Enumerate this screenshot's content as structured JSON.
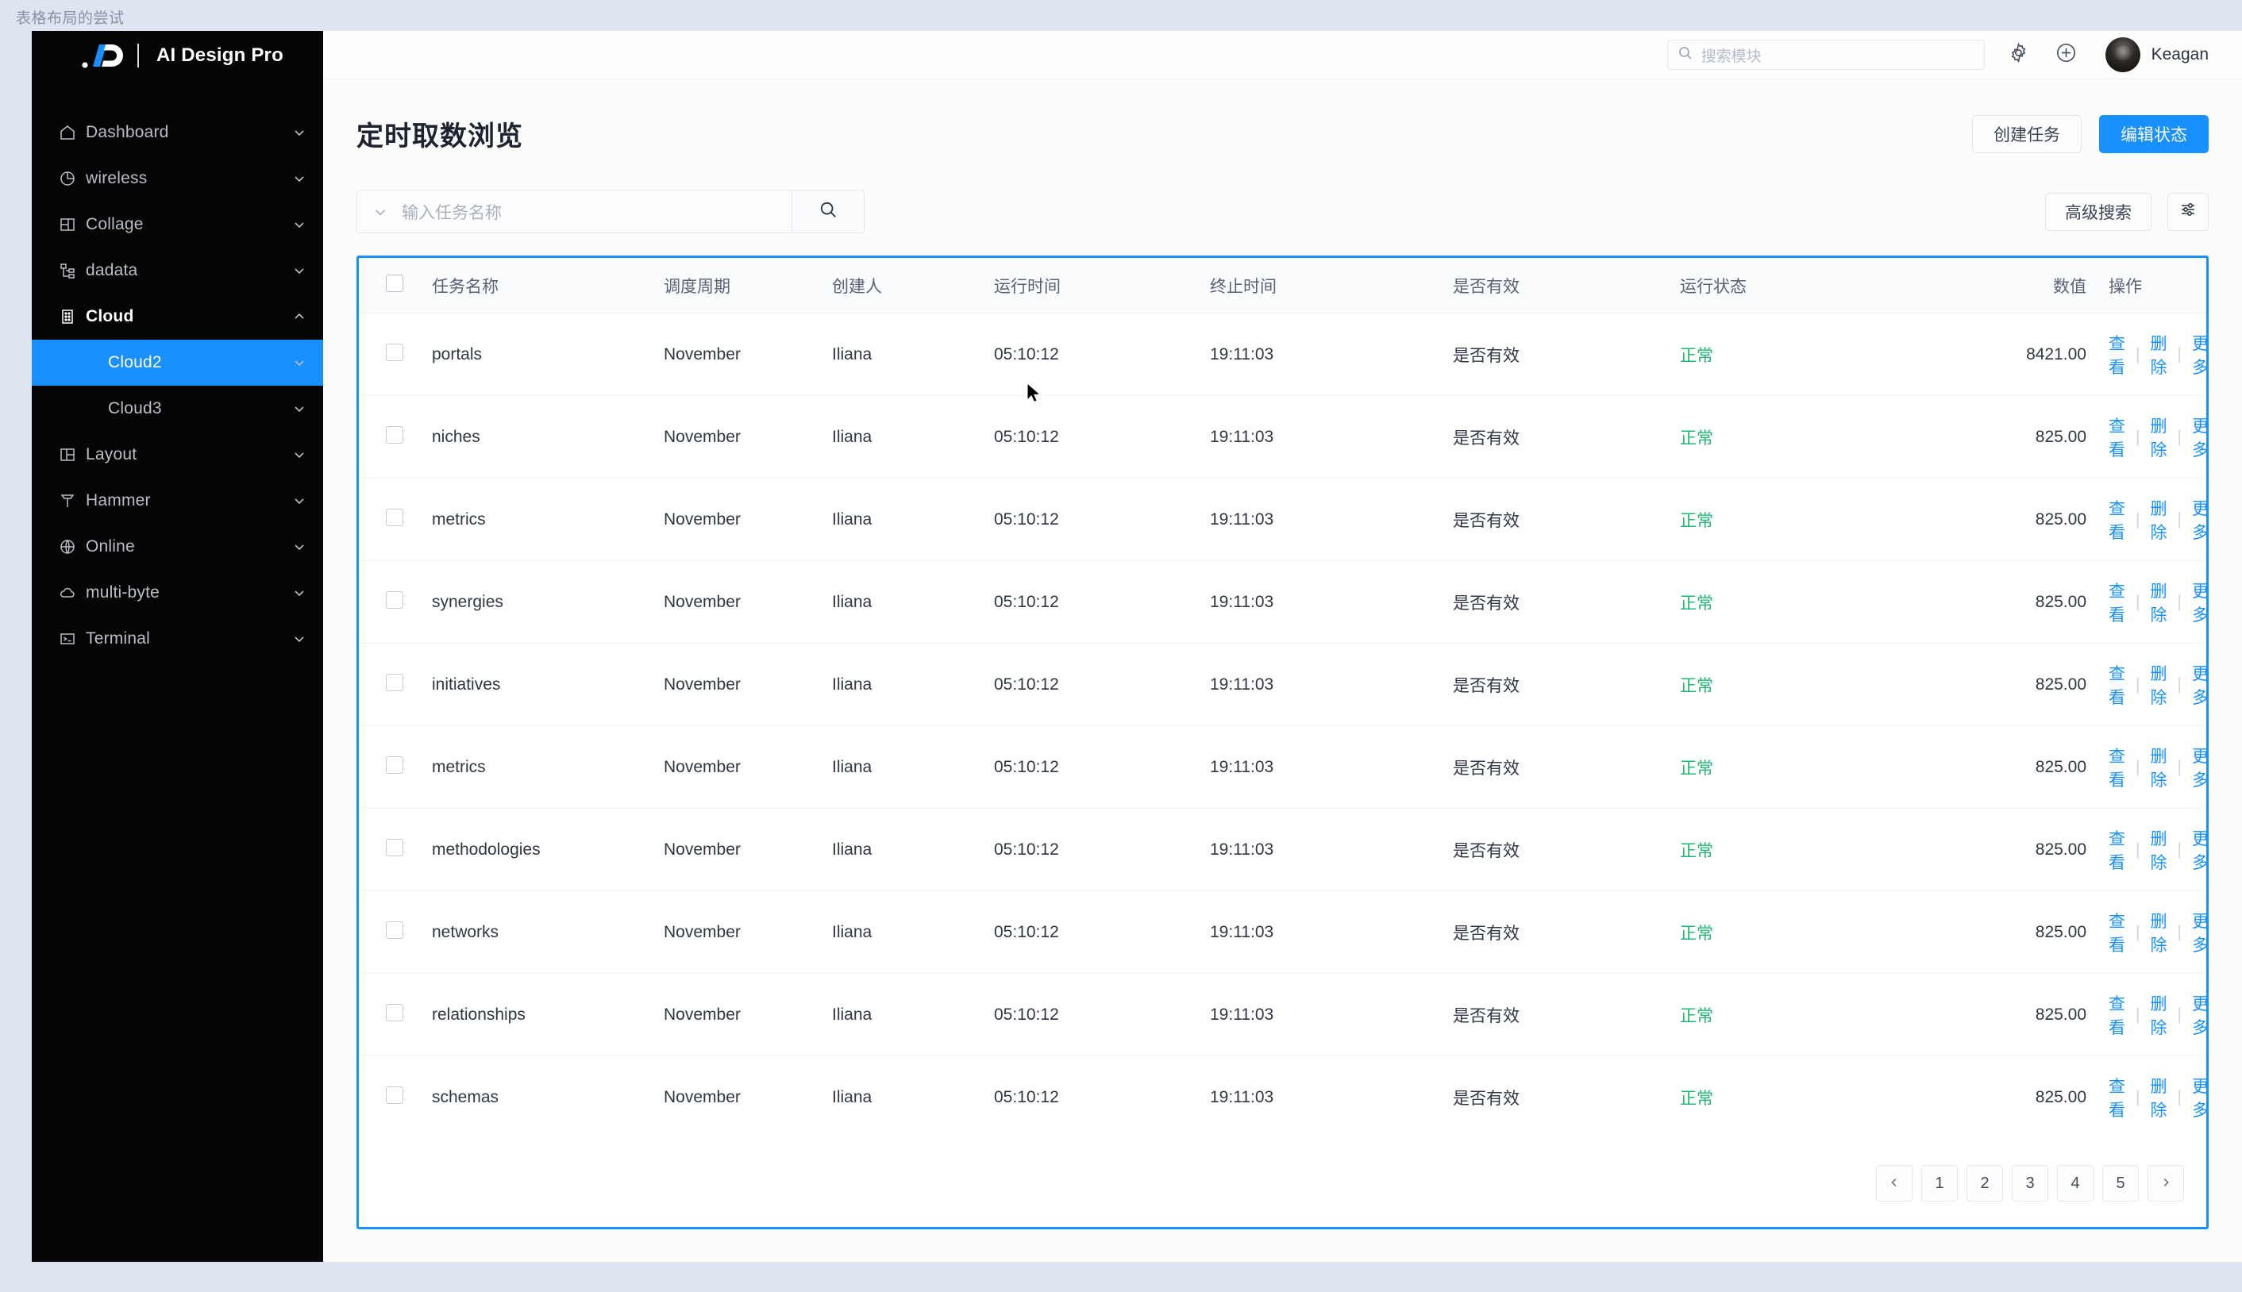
{
  "canvas_label": "表格布局的尝试",
  "brand": {
    "name": "AI Design Pro",
    "logo_icon": "ai-design-logo"
  },
  "sidebar": {
    "items": [
      {
        "label": "Dashboard",
        "icon": "home-icon",
        "chevron": "chevron-down-icon",
        "state": "normal"
      },
      {
        "label": "wireless",
        "icon": "pie-chart-icon",
        "chevron": "chevron-down-icon",
        "state": "normal"
      },
      {
        "label": "Collage",
        "icon": "layout-left-icon",
        "chevron": "chevron-down-icon",
        "state": "normal"
      },
      {
        "label": "dadata",
        "icon": "sitemap-icon",
        "chevron": "chevron-down-icon",
        "state": "normal"
      },
      {
        "label": "Cloud",
        "icon": "building-icon",
        "chevron": "chevron-up-icon",
        "state": "open"
      },
      {
        "label": "Cloud2",
        "icon": "",
        "chevron": "chevron-down-icon",
        "state": "active",
        "sub": true
      },
      {
        "label": "Cloud3",
        "icon": "",
        "chevron": "chevron-down-icon",
        "state": "normal",
        "sub": true
      },
      {
        "label": "Layout",
        "icon": "layout-right-icon",
        "chevron": "chevron-down-icon",
        "state": "normal"
      },
      {
        "label": "Hammer",
        "icon": "hammer-icon",
        "chevron": "chevron-down-icon",
        "state": "normal"
      },
      {
        "label": "Online",
        "icon": "globe-icon",
        "chevron": "chevron-down-icon",
        "state": "normal"
      },
      {
        "label": "multi-byte",
        "icon": "cloud-icon",
        "chevron": "chevron-down-icon",
        "state": "normal"
      },
      {
        "label": "Terminal",
        "icon": "terminal-icon",
        "chevron": "chevron-down-icon",
        "state": "normal"
      }
    ]
  },
  "topbar": {
    "search_placeholder": "搜索模块",
    "search_icon": "search-icon",
    "settings_icon": "gear-icon",
    "add_icon": "plus-circle-icon",
    "user_name": "Keagan",
    "avatar_icon": "avatar"
  },
  "page": {
    "title": "定时取数浏览",
    "create_task_label": "创建任务",
    "edit_status_label": "编辑状态"
  },
  "filters": {
    "task_search_placeholder": "输入任务名称",
    "task_search_value": "",
    "dropdown_icon": "chevron-down-icon",
    "search_icon": "search-icon",
    "advanced_search_label": "高级搜索",
    "column_settings_icon": "sliders-icon"
  },
  "table": {
    "columns": [
      {
        "key": "check",
        "label": ""
      },
      {
        "key": "name",
        "label": "任务名称"
      },
      {
        "key": "cycle",
        "label": "调度周期"
      },
      {
        "key": "creator",
        "label": "创建人"
      },
      {
        "key": "runtime",
        "label": "运行时间"
      },
      {
        "key": "endtime",
        "label": "终止时间"
      },
      {
        "key": "valid",
        "label": "是否有效"
      },
      {
        "key": "status",
        "label": "运行状态"
      },
      {
        "key": "value",
        "label": "数值"
      },
      {
        "key": "ops",
        "label": "操作"
      }
    ],
    "op_labels": {
      "view": "查看",
      "delete": "删除",
      "more": "更多"
    },
    "rows": [
      {
        "name": "portals",
        "cycle": "November",
        "creator": "Iliana",
        "runtime": "05:10:12",
        "endtime": "19:11:03",
        "valid": "是否有效",
        "status": "正常",
        "value": "8421.00"
      },
      {
        "name": "niches",
        "cycle": "November",
        "creator": "Iliana",
        "runtime": "05:10:12",
        "endtime": "19:11:03",
        "valid": "是否有效",
        "status": "正常",
        "value": "825.00"
      },
      {
        "name": "metrics",
        "cycle": "November",
        "creator": "Iliana",
        "runtime": "05:10:12",
        "endtime": "19:11:03",
        "valid": "是否有效",
        "status": "正常",
        "value": "825.00"
      },
      {
        "name": "synergies",
        "cycle": "November",
        "creator": "Iliana",
        "runtime": "05:10:12",
        "endtime": "19:11:03",
        "valid": "是否有效",
        "status": "正常",
        "value": "825.00"
      },
      {
        "name": "initiatives",
        "cycle": "November",
        "creator": "Iliana",
        "runtime": "05:10:12",
        "endtime": "19:11:03",
        "valid": "是否有效",
        "status": "正常",
        "value": "825.00"
      },
      {
        "name": "metrics",
        "cycle": "November",
        "creator": "Iliana",
        "runtime": "05:10:12",
        "endtime": "19:11:03",
        "valid": "是否有效",
        "status": "正常",
        "value": "825.00"
      },
      {
        "name": "methodologies",
        "cycle": "November",
        "creator": "Iliana",
        "runtime": "05:10:12",
        "endtime": "19:11:03",
        "valid": "是否有效",
        "status": "正常",
        "value": "825.00"
      },
      {
        "name": "networks",
        "cycle": "November",
        "creator": "Iliana",
        "runtime": "05:10:12",
        "endtime": "19:11:03",
        "valid": "是否有效",
        "status": "正常",
        "value": "825.00"
      },
      {
        "name": "relationships",
        "cycle": "November",
        "creator": "Iliana",
        "runtime": "05:10:12",
        "endtime": "19:11:03",
        "valid": "是否有效",
        "status": "正常",
        "value": "825.00"
      },
      {
        "name": "schemas",
        "cycle": "November",
        "creator": "Iliana",
        "runtime": "05:10:12",
        "endtime": "19:11:03",
        "valid": "是否有效",
        "status": "正常",
        "value": "825.00"
      }
    ]
  },
  "pagination": {
    "prev_icon": "chevron-left-icon",
    "next_icon": "chevron-right-icon",
    "pages": [
      "1",
      "2",
      "3",
      "4",
      "5"
    ],
    "current": "1"
  },
  "colors": {
    "accent": "#1890ff",
    "sidebar_bg": "#050505",
    "status_ok": "#22b573",
    "page_bg": "#dee5f0"
  }
}
